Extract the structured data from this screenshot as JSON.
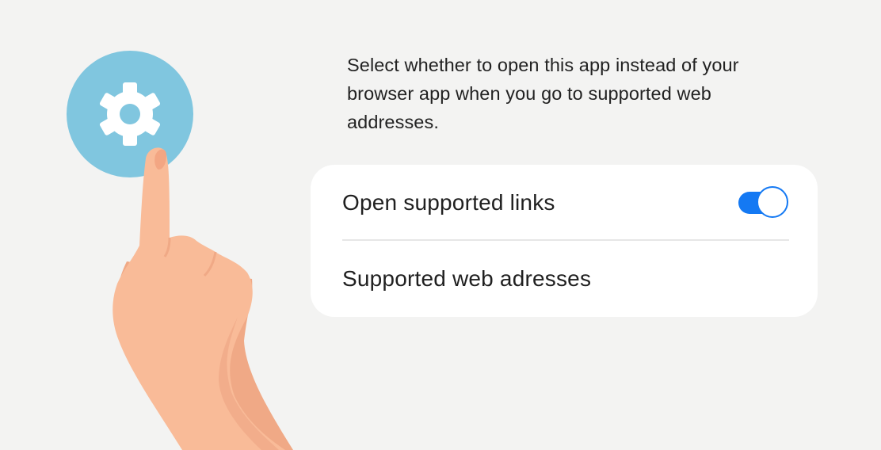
{
  "description": "Select whether to open this app instead of your browser app when you go to supported web addresses.",
  "settings": {
    "open_supported_links": {
      "label": "Open supported links",
      "toggle_on": true
    },
    "supported_web_addresses": {
      "label": "Supported web adresses"
    }
  },
  "icons": {
    "settings": "gear-icon",
    "pointer": "pointing-hand"
  },
  "colors": {
    "background": "#f3f3f2",
    "accent": "#1479f3",
    "gear_circle": "#80c6df",
    "skin": "#f9bb98"
  }
}
